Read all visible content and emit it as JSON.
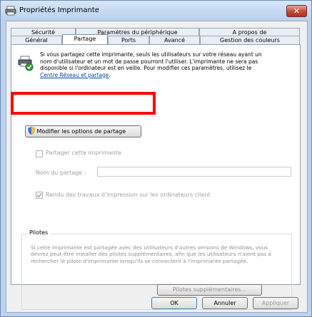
{
  "window": {
    "title": "Propriétés Imprimante",
    "close_glyph": "✕"
  },
  "tabs": {
    "row1": [
      "Sécurité",
      "Paramètres du périphérique",
      "A propos de"
    ],
    "row2": [
      "Général",
      "Partage",
      "Ports",
      "Avancé",
      "Gestion des couleurs"
    ],
    "active": "Partage"
  },
  "sharing": {
    "info_text_before_link": "Si vous partagez cette imprimante, seuls les utilisateurs sur votre réseau ayant un nom d'utilisateur et un mot de passe pourront l'utiliser. L'imprimante ne sera pas disponible si l'ordinateur est en veille. Pour modifier ces paramètres, utilisez le ",
    "info_link": "Centre Réseau et partage",
    "info_text_after_link": ".",
    "change_options_button": "Modifier les options de partage",
    "share_checkbox_label": "Partager cette imprimante",
    "share_name_label": "Nom du partage :",
    "share_name_value": "",
    "render_checkbox_label": "Rendu des travaux d'impression sur les ordinateurs client"
  },
  "drivers": {
    "group_title": "Pilotes",
    "text": "Si cette imprimante est partagée avec des utilisateurs d'autres versions de Windows, vous devrez peut-être installer des pilotes supplémentaires, afin que les utilisateurs n'aient pas à rechercher le pilote d'imprimante lorsqu'ils se connectent à l'imprimante partagée.",
    "additional_button": "Pilotes supplémentaires..."
  },
  "footer": {
    "ok": "OK",
    "cancel": "Annuler",
    "apply": "Appliquer"
  },
  "colors": {
    "highlight": "#ff0000",
    "link": "#0645ad"
  },
  "icons": [
    "printer-icon",
    "close-icon",
    "printer-share-icon",
    "shield-icon",
    "checkmark-icon"
  ]
}
